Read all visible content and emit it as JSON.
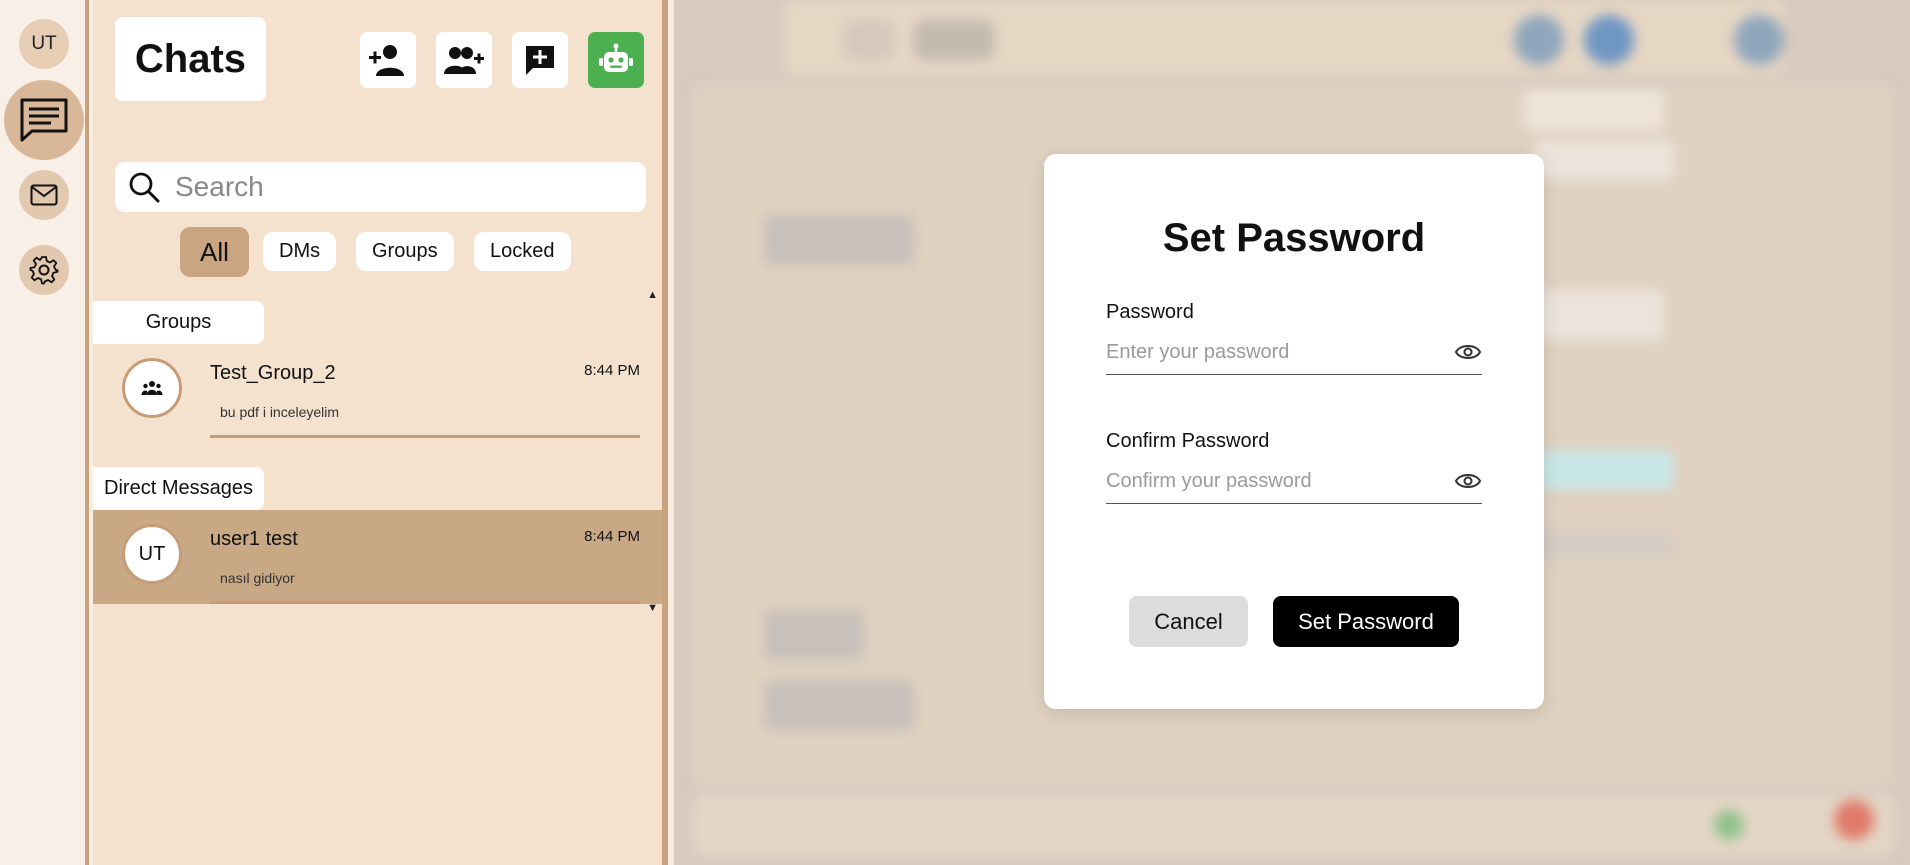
{
  "rail": {
    "avatar_initials": "UT",
    "items": [
      {
        "icon": "chat-bubble-icon",
        "active": true
      },
      {
        "icon": "mail-icon",
        "active": false
      },
      {
        "icon": "gear-icon",
        "active": false
      }
    ]
  },
  "sidebar": {
    "title": "Chats",
    "header_buttons": [
      {
        "icon": "add-contact-icon"
      },
      {
        "icon": "create-group-icon"
      },
      {
        "icon": "new-message-icon"
      },
      {
        "icon": "robot-icon",
        "color": "#4caf50"
      }
    ],
    "search": {
      "placeholder": "Search"
    },
    "filters": [
      {
        "label": "All",
        "active": true
      },
      {
        "label": "DMs"
      },
      {
        "label": "Groups"
      },
      {
        "label": "Locked"
      }
    ],
    "sections": {
      "groups": {
        "label": "Groups",
        "items": [
          {
            "name": "Test_Group_2",
            "time": "8:44 PM",
            "preview": "bu pdf i inceleyelim",
            "avatar_icon": "group-icon"
          }
        ]
      },
      "direct": {
        "label": "Direct Messages",
        "items": [
          {
            "name": "user1 test",
            "time": "8:44 PM",
            "preview": "nasıl gidiyor",
            "avatar_initials": "UT",
            "selected": true
          }
        ]
      }
    }
  },
  "modal": {
    "title": "Set Password",
    "password": {
      "label": "Password",
      "placeholder": "Enter your password"
    },
    "confirm": {
      "label": "Confirm Password",
      "placeholder": "Confirm your password"
    },
    "cancel_label": "Cancel",
    "submit_label": "Set Password"
  },
  "colors": {
    "accent": "#c9a581",
    "sidebar_bg": "#f4e2cf",
    "border": "#c8a27d",
    "primary_button": "#000000",
    "bot_button": "#4caf50"
  }
}
